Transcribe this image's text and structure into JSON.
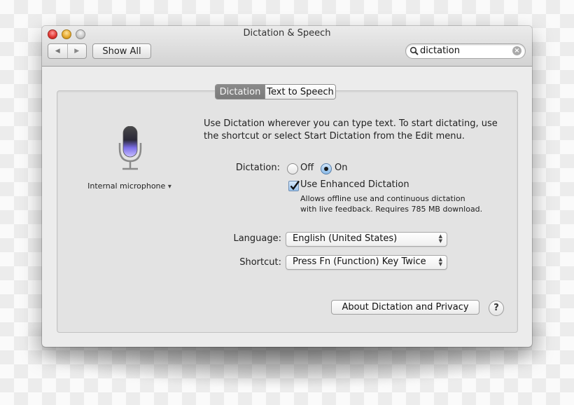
{
  "window": {
    "title": "Dictation & Speech"
  },
  "toolbar": {
    "back_icon": "back-arrow-icon",
    "forward_icon": "forward-arrow-icon",
    "show_all_label": "Show All",
    "search": {
      "value": "dictation",
      "placeholder": "",
      "clear_icon": "clear-icon"
    }
  },
  "tabs": [
    {
      "label": "Dictation",
      "selected": true
    },
    {
      "label": "Text to Speech",
      "selected": false
    }
  ],
  "left": {
    "mic_icon": "microphone-icon",
    "input_source": "Internal microphone",
    "dropdown_glyph": "▾"
  },
  "main": {
    "description": "Use Dictation wherever you can type text. To start dictating, use the shortcut or select Start Dictation from the Edit menu.",
    "dictation_label": "Dictation:",
    "dictation_options": [
      {
        "label": "Off",
        "selected": false
      },
      {
        "label": "On",
        "selected": true
      }
    ],
    "enhanced": {
      "label": "Use Enhanced Dictation",
      "checked": true,
      "note_line1": "Allows offline use and continuous dictation",
      "note_line2": "with live feedback. Requires 785 MB download."
    },
    "language_label": "Language:",
    "language_value": "English (United States)",
    "shortcut_label": "Shortcut:",
    "shortcut_value": "Press Fn (Function) Key Twice",
    "about_button": "About Dictation and Privacy",
    "help_button": "?"
  },
  "colors": {
    "close": "#e0342f",
    "minimize": "#e5a72a",
    "zoom": "#c8c8c8",
    "selected_tab": "#7f7f7f",
    "radio_selected": "#8bbbe9",
    "mic_glow": "#8f7dff"
  }
}
